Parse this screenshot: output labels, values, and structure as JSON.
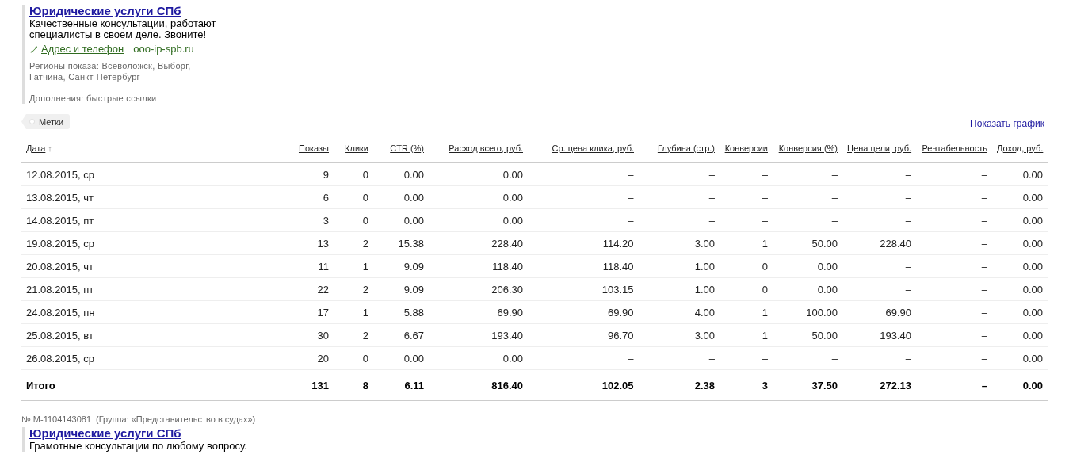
{
  "ad": {
    "title": "Юридические услуги СПб",
    "text": "Качественные консультации, работают специалисты в своем деле. Звоните!",
    "contact_link": "Адрес и телефон",
    "domain": "ooo-ip-spb.ru",
    "regions": "Регионы показа: Всеволожск, Выборг, Гатчина, Санкт-Петербург",
    "extensions": "Дополнения: быстрые ссылки"
  },
  "tags_button": "Метки",
  "show_chart_link": "Показать график",
  "table": {
    "columns": [
      {
        "label": "Дата",
        "sort_mark": "↑"
      },
      {
        "label": "Показы"
      },
      {
        "label": "Клики"
      },
      {
        "label": "CTR (%)"
      },
      {
        "label": "Расход всего, руб."
      },
      {
        "label": "Ср. цена клика, руб."
      },
      {
        "label": "Глубина (стр.)"
      },
      {
        "label": "Конверсии"
      },
      {
        "label": "Конверсия (%)"
      },
      {
        "label": "Цена цели, руб."
      },
      {
        "label": "Рентабельность"
      },
      {
        "label": "Доход, руб."
      }
    ],
    "rows": [
      [
        "12.08.2015, ср",
        "9",
        "0",
        "0.00",
        "0.00",
        "–",
        "–",
        "–",
        "–",
        "–",
        "–",
        "0.00"
      ],
      [
        "13.08.2015, чт",
        "6",
        "0",
        "0.00",
        "0.00",
        "–",
        "–",
        "–",
        "–",
        "–",
        "–",
        "0.00"
      ],
      [
        "14.08.2015, пт",
        "3",
        "0",
        "0.00",
        "0.00",
        "–",
        "–",
        "–",
        "–",
        "–",
        "–",
        "0.00"
      ],
      [
        "19.08.2015, ср",
        "13",
        "2",
        "15.38",
        "228.40",
        "114.20",
        "3.00",
        "1",
        "50.00",
        "228.40",
        "–",
        "0.00"
      ],
      [
        "20.08.2015, чт",
        "11",
        "1",
        "9.09",
        "118.40",
        "118.40",
        "1.00",
        "0",
        "0.00",
        "–",
        "–",
        "0.00"
      ],
      [
        "21.08.2015, пт",
        "22",
        "2",
        "9.09",
        "206.30",
        "103.15",
        "1.00",
        "0",
        "0.00",
        "–",
        "–",
        "0.00"
      ],
      [
        "24.08.2015, пн",
        "17",
        "1",
        "5.88",
        "69.90",
        "69.90",
        "4.00",
        "1",
        "100.00",
        "69.90",
        "–",
        "0.00"
      ],
      [
        "25.08.2015, вт",
        "30",
        "2",
        "6.67",
        "193.40",
        "96.70",
        "3.00",
        "1",
        "50.00",
        "193.40",
        "–",
        "0.00"
      ],
      [
        "26.08.2015, ср",
        "20",
        "0",
        "0.00",
        "0.00",
        "–",
        "–",
        "–",
        "–",
        "–",
        "–",
        "0.00"
      ]
    ],
    "total": [
      "Итого",
      "131",
      "8",
      "6.11",
      "816.40",
      "102.05",
      "2.38",
      "3",
      "37.50",
      "272.13",
      "–",
      "0.00"
    ]
  },
  "next_ad": {
    "number": "№ M-1104143081",
    "group": "(Группа: «Представительство в судах»)",
    "title": "Юридические услуги СПб",
    "text": "Грамотные консультации по любому вопросу."
  }
}
